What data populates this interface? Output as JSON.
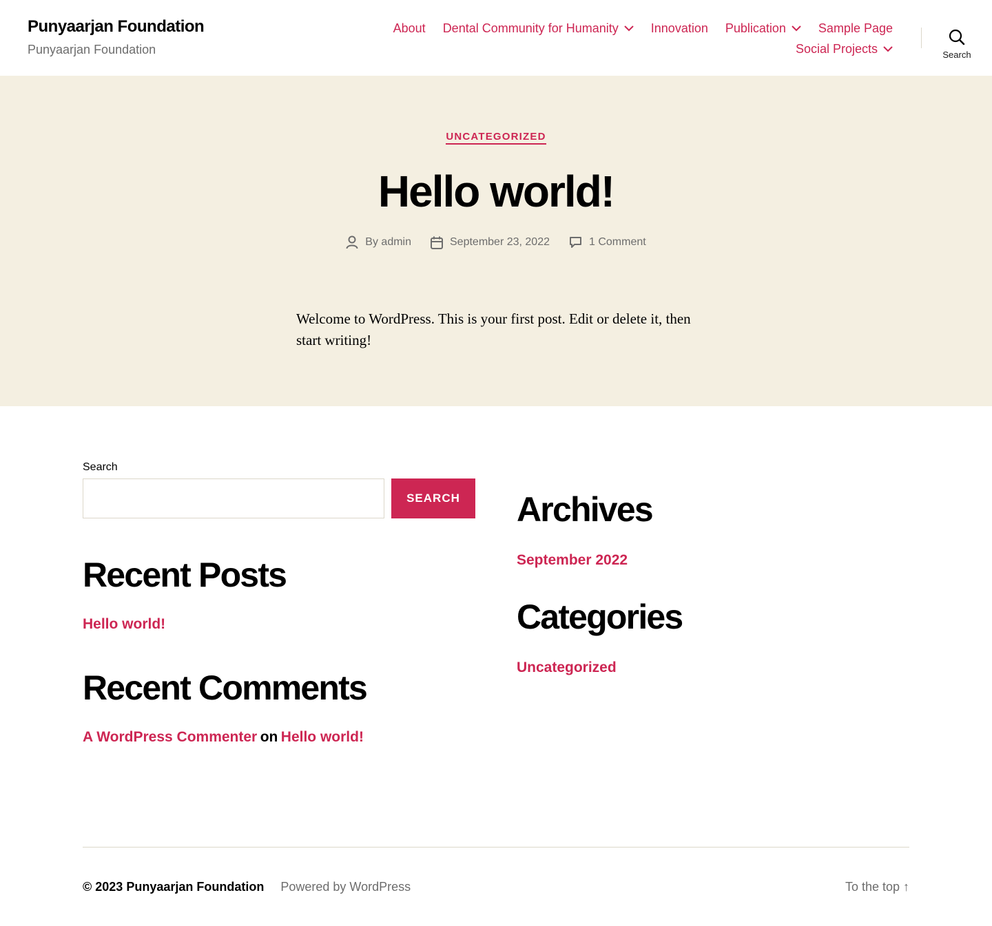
{
  "header": {
    "site_title": "Punyaarjan Foundation",
    "site_description": "Punyaarjan Foundation",
    "nav_row1": [
      {
        "label": "About",
        "has_submenu": false
      },
      {
        "label": "Dental Community for Humanity",
        "has_submenu": true
      },
      {
        "label": "Innovation",
        "has_submenu": false
      },
      {
        "label": "Publication",
        "has_submenu": true
      },
      {
        "label": "Sample Page",
        "has_submenu": false
      }
    ],
    "nav_row2": [
      {
        "label": "Social Projects",
        "has_submenu": true
      }
    ],
    "search_toggle_label": "Search"
  },
  "post": {
    "category": "Uncategorized",
    "title": "Hello world!",
    "author_prefix": "By",
    "author": "admin",
    "date": "September 23, 2022",
    "comments": "1 Comment",
    "content": "Welcome to WordPress. This is your first post. Edit or delete it, then start writing!"
  },
  "widgets": {
    "search": {
      "label": "Search",
      "value": "",
      "button_label": "Search"
    },
    "recent_posts": {
      "heading": "Recent Posts",
      "items": [
        "Hello world!"
      ]
    },
    "recent_comments": {
      "heading": "Recent Comments",
      "author": "A WordPress Commenter",
      "connector": "on",
      "post": "Hello world!"
    },
    "archives": {
      "heading": "Archives",
      "items": [
        "September 2022"
      ]
    },
    "categories": {
      "heading": "Categories",
      "items": [
        "Uncategorized"
      ]
    }
  },
  "footer": {
    "copyright_prefix": "© 2023",
    "copyright_site": "Punyaarjan Foundation",
    "powered_by": "Powered by WordPress",
    "to_top": "To the top ↑"
  },
  "colors": {
    "accent": "#cd2653",
    "hero_background": "#f4efe1",
    "muted_text": "#6d6d6d"
  }
}
